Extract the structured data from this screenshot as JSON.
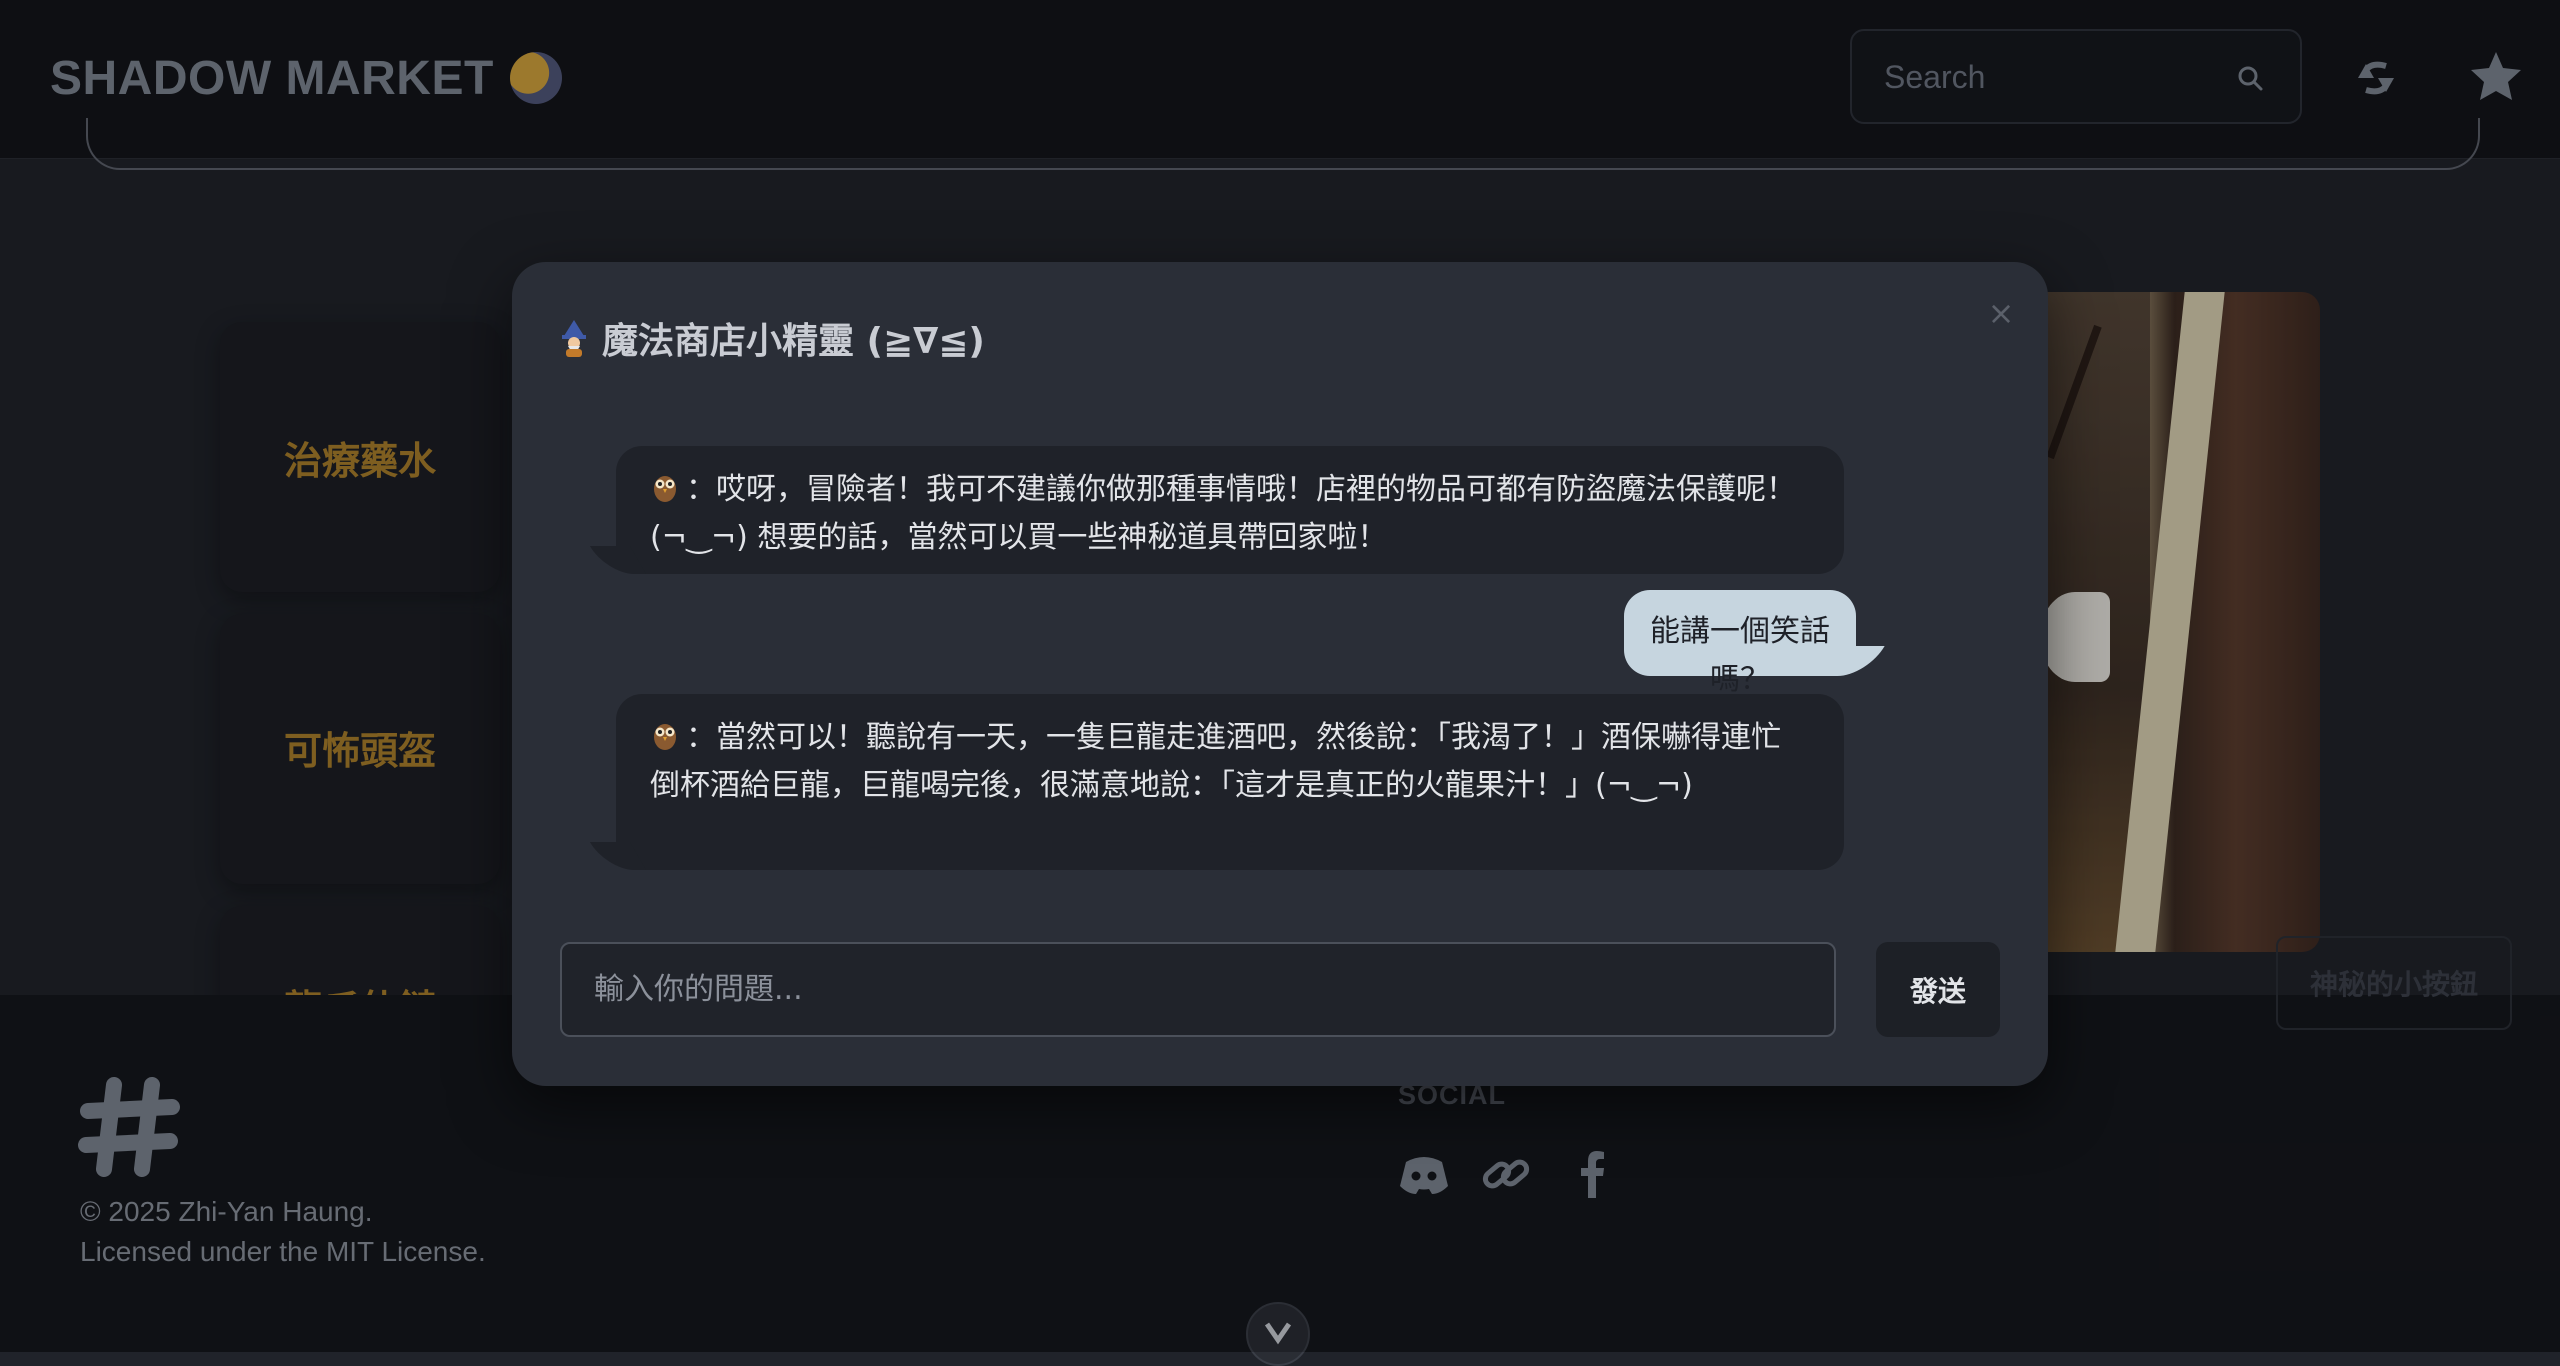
{
  "header": {
    "brand": "SHADOW MARKET",
    "search_placeholder": "Search",
    "icons": [
      "moon-icon",
      "search-icon",
      "sync-icon",
      "puzzle-icon"
    ]
  },
  "cards": [
    {
      "title": "治療藥水"
    },
    {
      "title": "可怖頭盔"
    },
    {
      "title": "龍爪仙鏈"
    }
  ],
  "secret_button": "神秘的小按鈕",
  "footer": {
    "copyright": "© 2025 Zhi-Yan Haung.",
    "license": "Licensed under the MIT License.",
    "social_title": "SOCIAL",
    "social_icons": [
      "discord-icon",
      "link-icon",
      "facebook-icon"
    ]
  },
  "chat": {
    "title": "魔法商店小精靈 (≧∇≦)",
    "close": "×",
    "messages": [
      {
        "role": "bot",
        "prefix": "：",
        "text": "哎呀，冒險者！我可不建議你做那種事情哦！店裡的物品可都有防盜魔法保護呢！(¬‿¬) 想要的話，當然可以買一些神秘道具帶回家啦！"
      },
      {
        "role": "user",
        "text": "能講一個笑話嗎？"
      },
      {
        "role": "bot",
        "prefix": "：",
        "text": "當然可以！聽說有一天，一隻巨龍走進酒吧，然後說：「我渴了！」酒保嚇得連忙倒杯酒給巨龍，巨龍喝完後，很滿意地說：「這才是真正的火龍果汁！」(¬‿¬)"
      }
    ],
    "input_placeholder": "輸入你的問題...",
    "send_label": "發送"
  },
  "colors": {
    "background": "#20232a",
    "header": "#13151a",
    "accent_gold": "#a97e2b",
    "user_bubble": "#c6d5df",
    "bot_bubble": "#1f2229"
  }
}
